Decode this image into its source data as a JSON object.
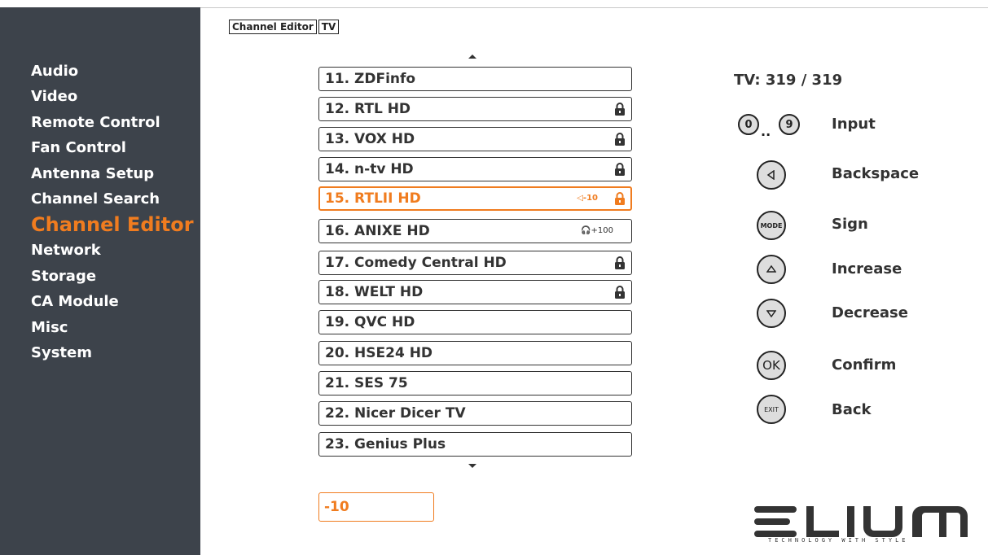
{
  "breadcrumb": [
    "Channel Editor",
    "TV"
  ],
  "menu": [
    {
      "label": "Audio"
    },
    {
      "label": "Video"
    },
    {
      "label": "Remote Control"
    },
    {
      "label": "Fan Control"
    },
    {
      "label": "Antenna Setup"
    },
    {
      "label": "Channel Search"
    },
    {
      "label": "Channel Editor",
      "active": true
    },
    {
      "label": "Network"
    },
    {
      "label": "Storage"
    },
    {
      "label": "CA Module"
    },
    {
      "label": "Misc"
    },
    {
      "label": "System"
    }
  ],
  "channels": [
    {
      "name": "11. ZDFinfo",
      "locked": false
    },
    {
      "name": "12. RTL HD",
      "locked": true
    },
    {
      "name": "13. VOX HD",
      "locked": true
    },
    {
      "name": "14. n-tv HD",
      "locked": true
    },
    {
      "name": "15. RTLII HD",
      "locked": true,
      "selected": true,
      "volume": "◁-10"
    },
    {
      "name": "16. ANIXE HD",
      "locked": false,
      "audio": "🎧+100"
    },
    {
      "name": "17. Comedy Central HD",
      "locked": true
    },
    {
      "name": "18. WELT HD",
      "locked": true
    },
    {
      "name": "19. QVC HD",
      "locked": false
    },
    {
      "name": "20. HSE24 HD",
      "locked": false
    },
    {
      "name": "21. SES 75",
      "locked": false
    },
    {
      "name": "22. Nicer Dicer TV",
      "locked": false
    },
    {
      "name": "23. Genius Plus",
      "locked": false
    }
  ],
  "input_value": "-10",
  "tv_count": "TV: 319 / 319",
  "keys": {
    "zero": "0",
    "dots": "..",
    "nine": "9",
    "mode": "MODE",
    "ok": "OK",
    "exit": "EXIT"
  },
  "legend": {
    "input": "Input",
    "backspace": "Backspace",
    "sign": "Sign",
    "increase": "Increase",
    "decrease": "Decrease",
    "confirm": "Confirm",
    "back": "Back"
  },
  "logo": {
    "text": "ELIUM",
    "tagline": "TECHNOLOGY WITH STYLE"
  },
  "colors": {
    "accent": "#f07c1f",
    "sidebar": "#3d434b"
  }
}
